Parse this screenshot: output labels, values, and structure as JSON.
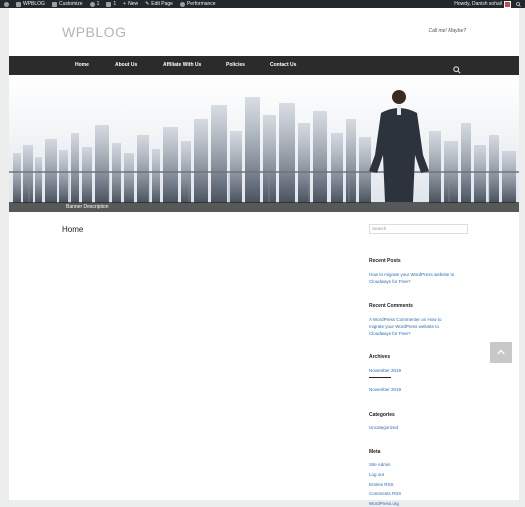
{
  "admin_bar": {
    "site_name": "WPBLOG",
    "customize": "Customize",
    "updates_count": "1",
    "comments_count": "1",
    "new": "New",
    "edit_page": "Edit Page",
    "performance": "Performance",
    "howdy": "Howdy, Danish sohail"
  },
  "header": {
    "logo": "WPBLOG",
    "tagline": "Call me! Maybe?"
  },
  "nav": {
    "items": [
      "Home",
      "About Us",
      "Affiliate With Us",
      "Policies",
      "Contact Us"
    ]
  },
  "banner": {
    "caption": "Banner Description"
  },
  "main": {
    "title": "Home"
  },
  "sidebar": {
    "search_placeholder": "Search",
    "recent_posts": {
      "title": "Recent Posts",
      "line1": "How to migrate your WordPress website to",
      "line2": "Cloudways for Free?"
    },
    "recent_comments": {
      "title": "Recent Comments",
      "line1": "A WordPress Commenter on How to",
      "line2": "migrate your WordPress website to",
      "line3": "Cloudways for Free?"
    },
    "archives": {
      "title": "Archives",
      "items": [
        "November 2019",
        "November 2019"
      ]
    },
    "categories": {
      "title": "Categories",
      "items": [
        "Uncategorized"
      ]
    },
    "meta": {
      "title": "Meta",
      "items": [
        "Site Admin",
        "Log out",
        "Entries RSS",
        "Comments RSS",
        "WordPress.org"
      ]
    }
  },
  "colors": {
    "admin_bar_bg": "#23282d",
    "nav_bg": "#2b2b2b",
    "link": "#2a6db5",
    "page_bg": "#eceeee"
  }
}
